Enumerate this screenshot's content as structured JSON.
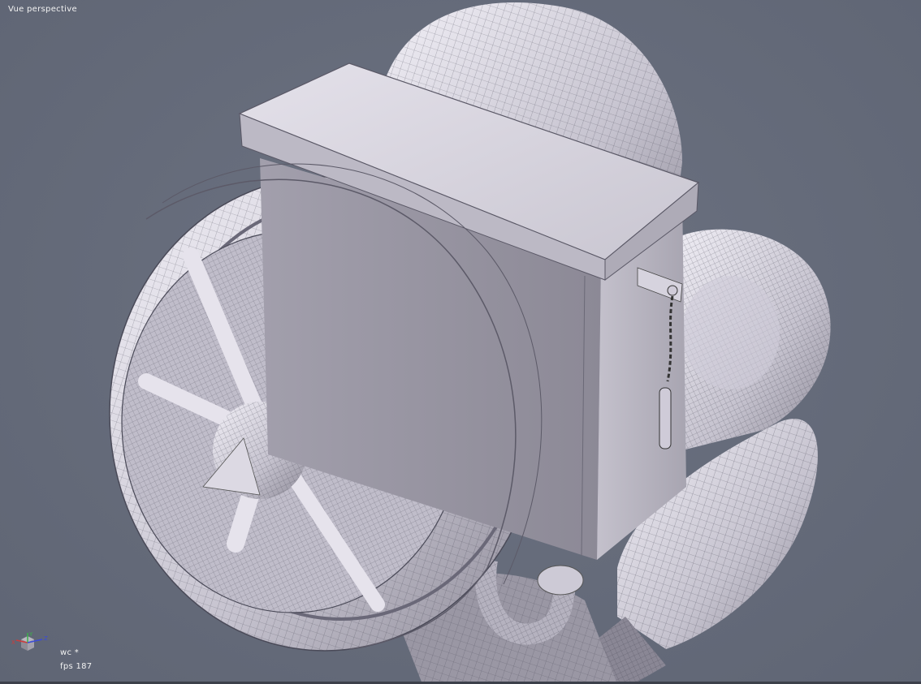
{
  "viewport": {
    "view_label": "Vue perspective",
    "background_color": "#646a79",
    "model_color": "#d9d6e0"
  },
  "status": {
    "workspace": "wc *",
    "fps": "fps 187"
  },
  "axis_gizmo": {
    "x_label": "X",
    "y_label": "Y",
    "z_label": "Z",
    "x_color": "#d03a3a",
    "y_color": "#3ab04a",
    "z_color": "#3a4ad8"
  }
}
